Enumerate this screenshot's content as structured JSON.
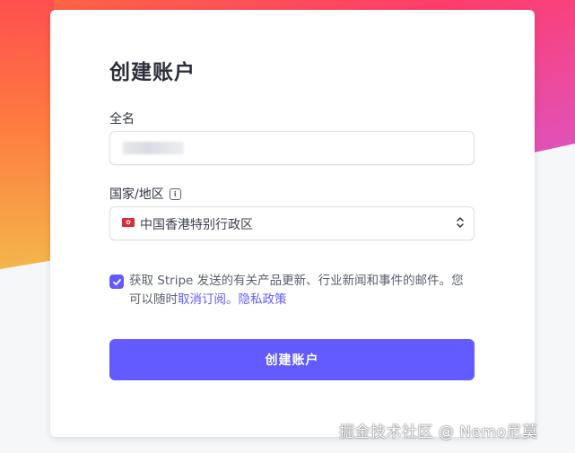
{
  "form": {
    "title": "创建账户",
    "name_label": "全名",
    "name_value": "•••••••",
    "country_label": "国家/地区",
    "country_info_icon": "info-icon",
    "country_value": "中国香港特别行政区",
    "country_flag_icon": "hong-kong-flag-icon",
    "consent_checked": true,
    "consent_text": "获取 Stripe 发送的有关产品更新、行业新闻和事件的邮件。您可以随时",
    "unsubscribe_link": "取消订阅。",
    "privacy_link": "隐私政策",
    "submit_label": "创建账户"
  },
  "colors": {
    "accent": "#635bff",
    "text": "#2b2f3a"
  },
  "watermark": "掘金技术社区 @ Nemo尼莫"
}
